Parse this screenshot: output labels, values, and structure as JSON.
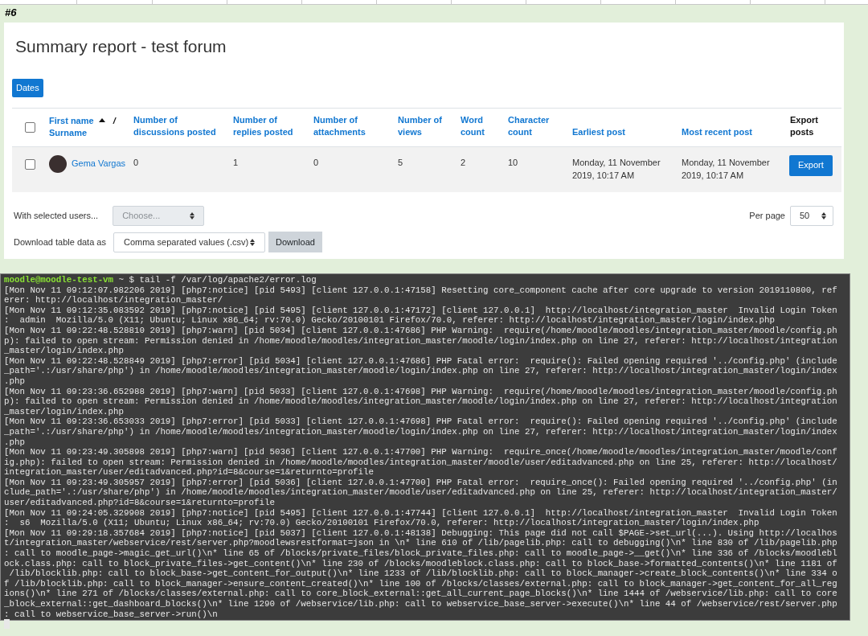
{
  "sheet_label": "#6",
  "report": {
    "title": "Summary report - test forum",
    "dates_button": "Dates",
    "select_all": {
      "checked": false
    },
    "columns": [
      {
        "kind": "name",
        "first": "First name",
        "sorted_ascending": true,
        "separator": "/",
        "second": "Surname"
      },
      {
        "kind": "link",
        "label": "Number of discussions posted"
      },
      {
        "kind": "link",
        "label": "Number of replies posted"
      },
      {
        "kind": "link",
        "label": "Number of attachments"
      },
      {
        "kind": "link",
        "label": "Number of views"
      },
      {
        "kind": "link",
        "label": "Word count"
      },
      {
        "kind": "link",
        "label": "Character count"
      },
      {
        "kind": "link",
        "label": "Earliest post"
      },
      {
        "kind": "link",
        "label": "Most recent post"
      },
      {
        "kind": "plain",
        "label": "Export posts"
      }
    ],
    "rows": [
      {
        "checked": false,
        "cells": [
          "Gema Vargas",
          "0",
          "1",
          "0",
          "5",
          "2",
          "10",
          "Monday, 11 November 2019, 10:17 AM",
          "Monday, 11 November 2019, 10:17 AM",
          "Export"
        ]
      }
    ],
    "with_selected": {
      "label": "With selected users...",
      "value": "Choose...",
      "disabled": true
    },
    "per_page": {
      "label": "Per page",
      "value": "50"
    },
    "download": {
      "label": "Download table data as",
      "value": "Comma separated values (.csv)",
      "button": "Download"
    }
  },
  "terminal": {
    "prompt": {
      "user_host": "moodle@moodle-test-vm",
      "cwd": "~",
      "symbol": "$",
      "command": "tail -f /var/log/apache2/error.log"
    },
    "lines": [
      "[Mon Nov 11 09:12:07.982206 2019] [php7:notice] [pid 5493] [client 127.0.0.1:47158] Resetting core_component cache after core upgrade to version 2019110800, ref",
      "erer: http://localhost/integration_master/",
      "[Mon Nov 11 09:12:35.083592 2019] [php7:notice] [pid 5495] [client 127.0.0.1:47172] [client 127.0.0.1]  http://localhost/integration_master  Invalid Login Token",
      ":  admin  Mozilla/5.0 (X11; Ubuntu; Linux x86_64; rv:70.0) Gecko/20100101 Firefox/70.0, referer: http://localhost/integration_master/login/index.php",
      "[Mon Nov 11 09:22:48.528810 2019] [php7:warn] [pid 5034] [client 127.0.0.1:47686] PHP Warning:  require(/home/moodle/moodles/integration_master/moodle/config.ph",
      "p): failed to open stream: Permission denied in /home/moodle/moodles/integration_master/moodle/login/index.php on line 27, referer: http://localhost/integration",
      "_master/login/index.php",
      "[Mon Nov 11 09:22:48.528849 2019] [php7:error] [pid 5034] [client 127.0.0.1:47686] PHP Fatal error:  require(): Failed opening required '../config.php' (include",
      "_path='.:/usr/share/php') in /home/moodle/moodles/integration_master/moodle/login/index.php on line 27, referer: http://localhost/integration_master/login/index",
      ".php",
      "[Mon Nov 11 09:23:36.652988 2019] [php7:warn] [pid 5033] [client 127.0.0.1:47698] PHP Warning:  require(/home/moodle/moodles/integration_master/moodle/config.ph",
      "p): failed to open stream: Permission denied in /home/moodle/moodles/integration_master/moodle/login/index.php on line 27, referer: http://localhost/integration",
      "_master/login/index.php",
      "[Mon Nov 11 09:23:36.653033 2019] [php7:error] [pid 5033] [client 127.0.0.1:47698] PHP Fatal error:  require(): Failed opening required '../config.php' (include",
      "_path='.:/usr/share/php') in /home/moodle/moodles/integration_master/moodle/login/index.php on line 27, referer: http://localhost/integration_master/login/index",
      ".php",
      "[Mon Nov 11 09:23:49.305898 2019] [php7:warn] [pid 5036] [client 127.0.0.1:47700] PHP Warning:  require_once(/home/moodle/moodles/integration_master/moodle/conf",
      "ig.php): failed to open stream: Permission denied in /home/moodle/moodles/integration_master/moodle/user/editadvanced.php on line 25, referer: http://localhost/",
      "integration_master/user/editadvanced.php?id=8&course=1&returnto=profile",
      "[Mon Nov 11 09:23:49.305957 2019] [php7:error] [pid 5036] [client 127.0.0.1:47700] PHP Fatal error:  require_once(): Failed opening required '../config.php' (in",
      "clude_path='.:/usr/share/php') in /home/moodle/moodles/integration_master/moodle/user/editadvanced.php on line 25, referer: http://localhost/integration_master/",
      "user/editadvanced.php?id=8&course=1&returnto=profile",
      "[Mon Nov 11 09:24:05.329908 2019] [php7:notice] [pid 5495] [client 127.0.0.1:47744] [client 127.0.0.1]  http://localhost/integration_master  Invalid Login Token",
      ":  s6  Mozilla/5.0 (X11; Ubuntu; Linux x86_64; rv:70.0) Gecko/20100101 Firefox/70.0, referer: http://localhost/integration_master/login/index.php",
      "[Mon Nov 11 09:29:18.357684 2019] [php7:notice] [pid 5037] [client 127.0.0.1:48138] Debugging: This page did not call $PAGE->set_url(...). Using http://localhos",
      "t/integration_master/webservice/rest/server.php?moodlewsrestformat=json in \\n* line 610 of /lib/pagelib.php: call to debugging()\\n* line 830 of /lib/pagelib.php",
      ": call to moodle_page->magic_get_url()\\n* line 65 of /blocks/private_files/block_private_files.php: call to moodle_page->__get()\\n* line 336 of /blocks/moodlebl",
      "ock.class.php: call to block_private_files->get_content()\\n* line 230 of /blocks/moodleblock.class.php: call to block_base->formatted_contents()\\n* line 1181 of",
      " /lib/blocklib.php: call to block_base->get_content_for_output()\\n* line 1233 of /lib/blocklib.php: call to block_manager->create_block_contents()\\n* line 334 o",
      "f /lib/blocklib.php: call to block_manager->ensure_content_created()\\n* line 100 of /blocks/classes/external.php: call to block_manager->get_content_for_all_reg",
      "ions()\\n* line 271 of /blocks/classes/external.php: call to core_block_external::get_all_current_page_blocks()\\n* line 1444 of /webservice/lib.php: call to core",
      "_block_external::get_dashboard_blocks()\\n* line 1290 of /webservice/lib.php: call to webservice_base_server->execute()\\n* line 44 of /webservice/rest/server.php",
      ": call to webservice_base_server->run()\\n"
    ],
    "cursor": true
  }
}
